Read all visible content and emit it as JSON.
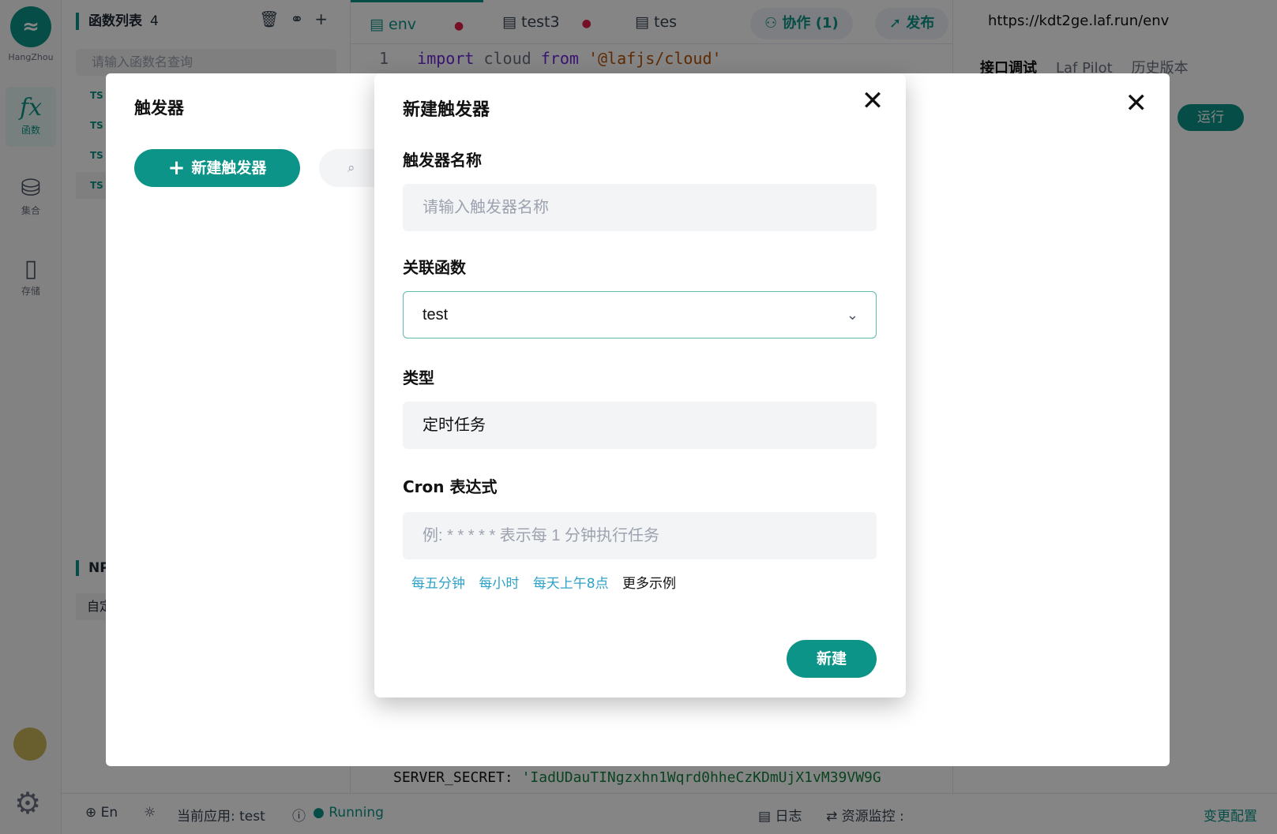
{
  "nav": {
    "region": "HangZhou",
    "items": [
      {
        "label": "函数",
        "icon": "function-icon"
      },
      {
        "label": "集合",
        "icon": "database-icon"
      },
      {
        "label": "存储",
        "icon": "storage-icon"
      }
    ]
  },
  "function_panel": {
    "title": "函数列表",
    "count": "4",
    "search_placeholder": "请输入函数名查询",
    "rows": [
      "TS",
      "TS",
      "TS",
      "TS"
    ],
    "npm_title": "NP",
    "npm_row": "自定"
  },
  "editor": {
    "tabs": [
      {
        "label": "env",
        "active": true
      },
      {
        "label": "test3",
        "active": false
      },
      {
        "label": "tes",
        "active": false
      }
    ],
    "line_number": "1",
    "code": {
      "kw1": "import",
      "ident": "cloud",
      "kw2": "from",
      "str": "'@lafjs/cloud'"
    },
    "secret_key": "SERVER_SECRET:",
    "secret_value": "'IadUDauTINgzxhn1Wqrd0hheCzKDmUjX1vM39VW9G"
  },
  "topbar": {
    "collab": "协作 (1)",
    "publish": "发布",
    "url": "https://kdt2ge.laf.run/env"
  },
  "right_panel": {
    "tabs": [
      "接口调试",
      "Laf Pilot",
      "历史版本"
    ],
    "run": "运行"
  },
  "statusbar": {
    "lang": "En",
    "current_app": "当前应用: test",
    "status": "Running",
    "logs": "日志",
    "monitor": "资源监控 :",
    "config": "变更配置"
  },
  "drawer": {
    "title": "触发器",
    "new_button": "新建触发器"
  },
  "modal": {
    "title": "新建触发器",
    "name_label": "触发器名称",
    "name_placeholder": "请输入触发器名称",
    "func_label": "关联函数",
    "func_value": "test",
    "type_label": "类型",
    "type_value": "定时任务",
    "cron_label": "Cron 表达式",
    "cron_placeholder": "例: * * * * * 表示每 1 分钟执行任务",
    "examples": [
      "每五分钟",
      "每小时",
      "每天上午8点"
    ],
    "more_examples": "更多示例",
    "submit": "新建"
  },
  "colors": {
    "accent": "#0d9488",
    "link": "#2ea2c8"
  }
}
